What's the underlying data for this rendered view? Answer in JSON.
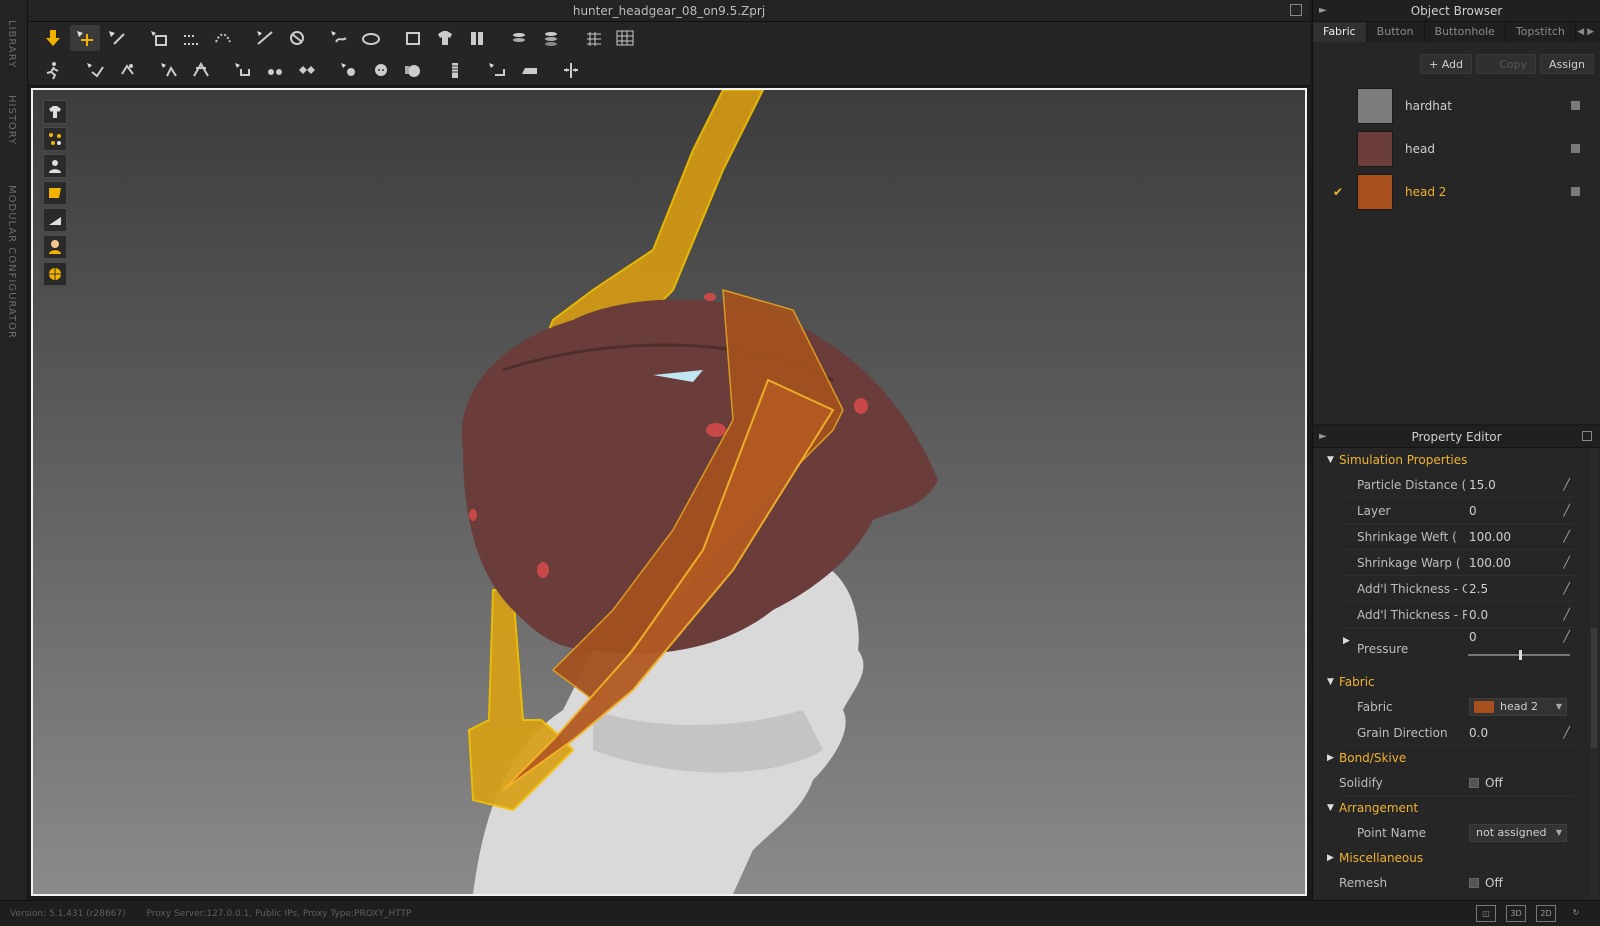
{
  "window": {
    "title": "hunter_headgear_08_on9.5.Zprj"
  },
  "side_tabs": [
    "LIBRARY",
    "HISTORY",
    "MODULAR CONFIGURATOR"
  ],
  "toolbar": {
    "row1": [
      "arrow-down-icon",
      "move-icon",
      "edit-pattern-icon",
      "rotate-icon",
      "transform-icon",
      "curve-icon",
      "segment-icon",
      "sewing-icon",
      "fold-icon",
      "arrange-icon",
      "avatar-icon",
      "layer-icon",
      "stack-icon",
      "grid-icon",
      "grid2-icon"
    ],
    "row2": [
      "simulate-icon",
      "pin-icon",
      "pin2-icon",
      "tack-icon",
      "tack2-icon",
      "button-icon",
      "buttonhole-icon",
      "topstitch-icon",
      "puckering-icon",
      "circle-icon",
      "lock-icon",
      "zipper-icon",
      "measure-icon",
      "ruler-icon",
      "snap-icon"
    ]
  },
  "object_browser": {
    "title": "Object Browser",
    "tabs": [
      "Fabric",
      "Button",
      "Buttonhole",
      "Topstitch"
    ],
    "active_tab": "Fabric",
    "actions": {
      "add": "+ Add",
      "copy": "Copy",
      "assign": "Assign"
    },
    "fabrics": [
      {
        "name": "hardhat",
        "color": "#7c7c7c",
        "selected": false
      },
      {
        "name": "head",
        "color": "#6b3e3c",
        "selected": true
      },
      {
        "name": "head 2",
        "color": "#a8501d",
        "selected": true
      }
    ]
  },
  "property_editor": {
    "title": "Property Editor",
    "sections": {
      "simulation": "Simulation Properties",
      "fabric": "Fabric",
      "bond": "Bond/Skive",
      "arrangement": "Arrangement",
      "misc": "Miscellaneous"
    },
    "sim_rows": [
      {
        "label": "Particle Distance (i",
        "value": "15.0"
      },
      {
        "label": "Layer",
        "value": "0"
      },
      {
        "label": "Shrinkage Weft (",
        "value": "100.00"
      },
      {
        "label": "Shrinkage Warp (",
        "value": "100.00"
      },
      {
        "label": "Add'l Thickness - Colli",
        "value": "2.5"
      },
      {
        "label": "Add'l Thickness - Ren",
        "value": "0.0"
      }
    ],
    "pressure": {
      "label": "Pressure",
      "value": "0",
      "slider_fraction": 0.5
    },
    "fabric_rows": {
      "fabric_label": "Fabric",
      "fabric_value": "head 2",
      "fabric_color": "#a8501d",
      "grain_label": "Grain Direction",
      "grain_value": "0.0"
    },
    "solidify": {
      "label": "Solidify",
      "value": "Off"
    },
    "arrangement_rows": {
      "point_label": "Point Name",
      "point_value": "not assigned"
    },
    "remesh": {
      "label": "Remesh",
      "value": "Off"
    }
  },
  "status": {
    "version": "Version: 5.1.431 (r28667)",
    "proxy": "Proxy Server:127.0.0.1, Public IPs, Proxy Type:PROXY_HTTP"
  },
  "view_buttons": [
    "3D",
    "2D"
  ],
  "colors": {
    "accent": "#f0b232",
    "selection": "#e8a020",
    "fabric_head": "#6b3e3c",
    "fabric_head2": "#a8501d"
  }
}
